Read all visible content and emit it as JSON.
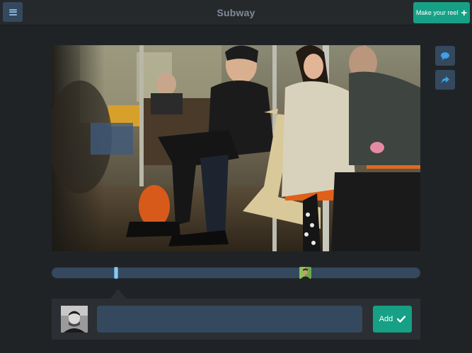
{
  "header": {
    "menu_icon": "hamburger-icon",
    "title": "Subway",
    "make_reel_label": "Make your reel",
    "make_reel_icon": "plus-icon"
  },
  "video": {
    "content": "photo of passengers seated on a subway train"
  },
  "side_actions": [
    {
      "icon": "comment-icon"
    },
    {
      "icon": "share-icon"
    }
  ],
  "timeline": {
    "playhead_fraction": 0.18,
    "comment_marker_fraction": 0.68
  },
  "comment": {
    "input_value": "",
    "input_placeholder": "",
    "add_label": "Add",
    "add_icon": "checkmark-icon"
  },
  "colors": {
    "background": "#202326",
    "header": "#26292c",
    "accent": "#16a085",
    "panel": "#34495e",
    "playhead": "#8ec7ef"
  }
}
